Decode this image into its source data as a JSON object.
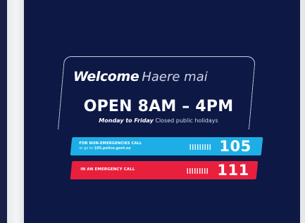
{
  "sign": {
    "welcome": "Welcome",
    "welcome_maori": "Haere mai",
    "hours": "OPEN 8AM – 4PM",
    "days_bold": "Monday to Friday",
    "days_rest": "Closed public holidays",
    "non_emergency": {
      "label_line1": "FOR NON-EMERGENCIES CALL",
      "label_line2_prefix": "or go to ",
      "label_line2_link": "105.police.govt.nz",
      "number": "105",
      "color": "#1daee6"
    },
    "emergency": {
      "label": "IN AN EMERGENCY CALL",
      "number": "111",
      "color": "#e8203e"
    }
  },
  "colors": {
    "panel": "#0d1845",
    "text": "#ffffff"
  }
}
